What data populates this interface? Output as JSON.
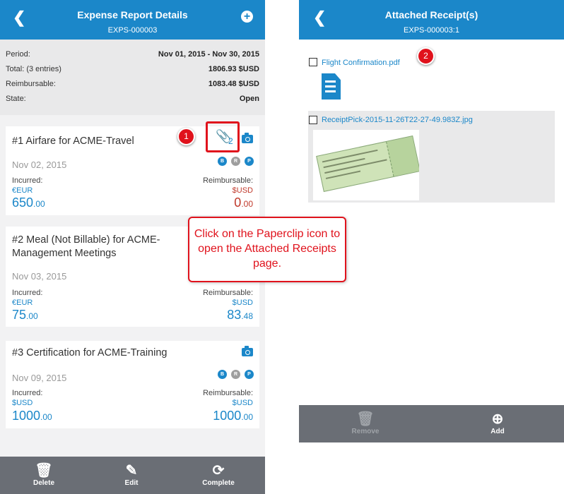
{
  "left": {
    "header": {
      "title": "Expense Report Details",
      "subtitle": "EXPS-000003"
    },
    "summary": [
      {
        "label": "Period:",
        "value": "Nov 01, 2015 - Nov 30, 2015"
      },
      {
        "label": "Total: (3 entries)",
        "value": "1806.93 $USD"
      },
      {
        "label": "Reimbursable:",
        "value": "1083.48 $USD"
      },
      {
        "label": "State:",
        "value": "Open"
      }
    ],
    "entries": [
      {
        "title": "#1 Airfare for ACME-Travel",
        "date": "Nov 02, 2015",
        "incurred_label": "Incurred:",
        "incurred_currency": "€EUR",
        "incurred_int": "650",
        "incurred_dec": ".00",
        "reimb_label": "Reimbursable:",
        "reimb_currency": "$USD",
        "reimb_int": "0",
        "reimb_dec": ".00",
        "attachments": "2",
        "badges": [
          "B",
          "R",
          "P"
        ]
      },
      {
        "title": "#2 Meal (Not Billable) for ACME-Management Meetings",
        "date": "Nov 03, 2015",
        "incurred_label": "Incurred:",
        "incurred_currency": "€EUR",
        "incurred_int": "75",
        "incurred_dec": ".00",
        "reimb_label": "Reimbursable:",
        "reimb_currency": "$USD",
        "reimb_int": "83",
        "reimb_dec": ".48"
      },
      {
        "title": "#3 Certification for ACME-Training",
        "date": "Nov 09, 2015",
        "incurred_label": "Incurred:",
        "incurred_currency": "$USD",
        "incurred_int": "1000",
        "incurred_dec": ".00",
        "reimb_label": "Reimbursable:",
        "reimb_currency": "$USD",
        "reimb_int": "1000",
        "reimb_dec": ".00",
        "badges": [
          "B",
          "R",
          "P"
        ]
      }
    ],
    "toolbar": {
      "delete": "Delete",
      "edit": "Edit",
      "complete": "Complete"
    }
  },
  "right": {
    "header": {
      "title": "Attached Receipt(s)",
      "subtitle": "EXPS-000003:1"
    },
    "files": [
      {
        "name": "Flight Confirmation.pdf",
        "icon": "pdf-file-icon"
      },
      {
        "name": "ReceiptPick-2015-11-26T22-27-49.983Z.jpg",
        "icon": "ticket-image"
      }
    ],
    "toolbar": {
      "remove": "Remove",
      "add": "Add"
    }
  },
  "callouts": {
    "step1": "1",
    "step2": "2",
    "tip": "Click on the Paperclip icon to open the Attached Receipts page."
  },
  "colors": {
    "brand": "#1b87c9",
    "toolbar": "#6a6e75",
    "highlight": "#e0121c",
    "negative": "#c0392b"
  }
}
